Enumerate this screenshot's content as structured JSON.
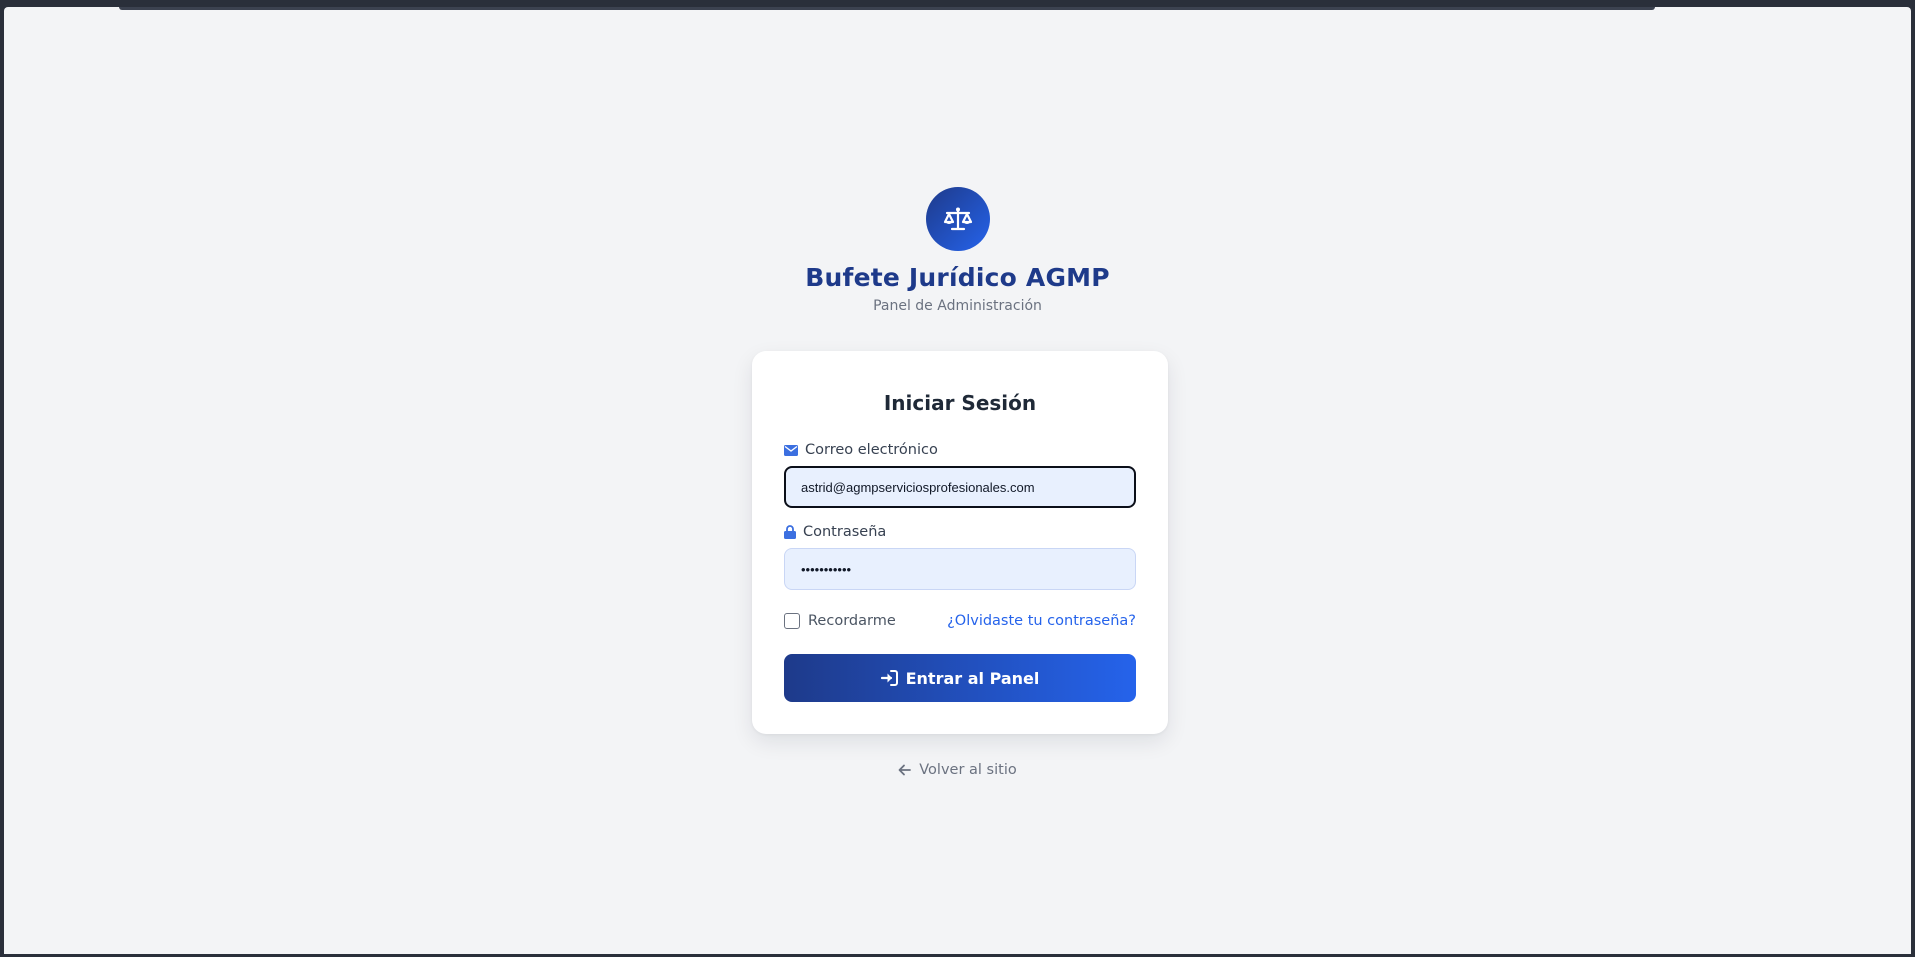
{
  "brand": {
    "logo_icon": "balance-scale-icon",
    "title": "Bufete Jurídico AGMP",
    "subtitle": "Panel de Administración"
  },
  "login": {
    "title": "Iniciar Sesión",
    "email": {
      "icon": "envelope-icon",
      "label": "Correo electrónico",
      "value": "astrid@agmpserviciosprofesionales.com"
    },
    "password": {
      "icon": "lock-icon",
      "label": "Contraseña",
      "value": "•••••••••••"
    },
    "remember": {
      "label": "Recordarme",
      "checked": false
    },
    "forgot_link": "¿Olvidaste tu contraseña?",
    "submit": {
      "icon": "sign-in-icon",
      "label": "Entrar al Panel"
    }
  },
  "back_link": {
    "icon": "arrow-left-icon",
    "label": "Volver al sitio"
  },
  "colors": {
    "primary_dark": "#1e3a8a",
    "primary": "#2563eb",
    "page_background": "#f3f4f6",
    "input_background": "#e8f0fe"
  }
}
